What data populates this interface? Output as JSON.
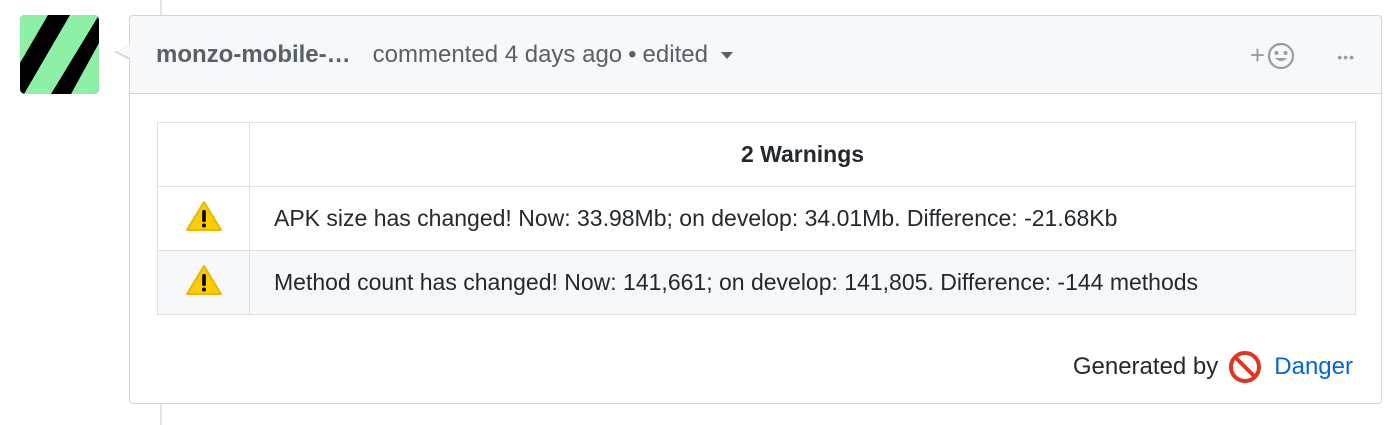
{
  "comment": {
    "author": "monzo-mobile-…",
    "action": "commented 4 days ago",
    "separator": "•",
    "edited_label": "edited",
    "reaction_plus": "+",
    "more_label": "•••"
  },
  "warnings_table": {
    "header_blank": "",
    "header_title": "2 Warnings",
    "rows": [
      {
        "icon": "warning-icon",
        "message": "APK size has changed! Now: 33.98Mb; on develop: 34.01Mb. Difference: -21.68Kb"
      },
      {
        "icon": "warning-icon",
        "message": "Method count has changed! Now: 141,661; on develop: 141,805. Difference: -144 methods"
      }
    ]
  },
  "footer": {
    "generated_by": "Generated by",
    "link_label": "Danger"
  },
  "colors": {
    "avatar_green": "#8ef0a6",
    "avatar_black": "#000000",
    "warning_yellow": "#ffcc00",
    "danger_red": "#e0361f",
    "link_blue": "#0366d6"
  }
}
